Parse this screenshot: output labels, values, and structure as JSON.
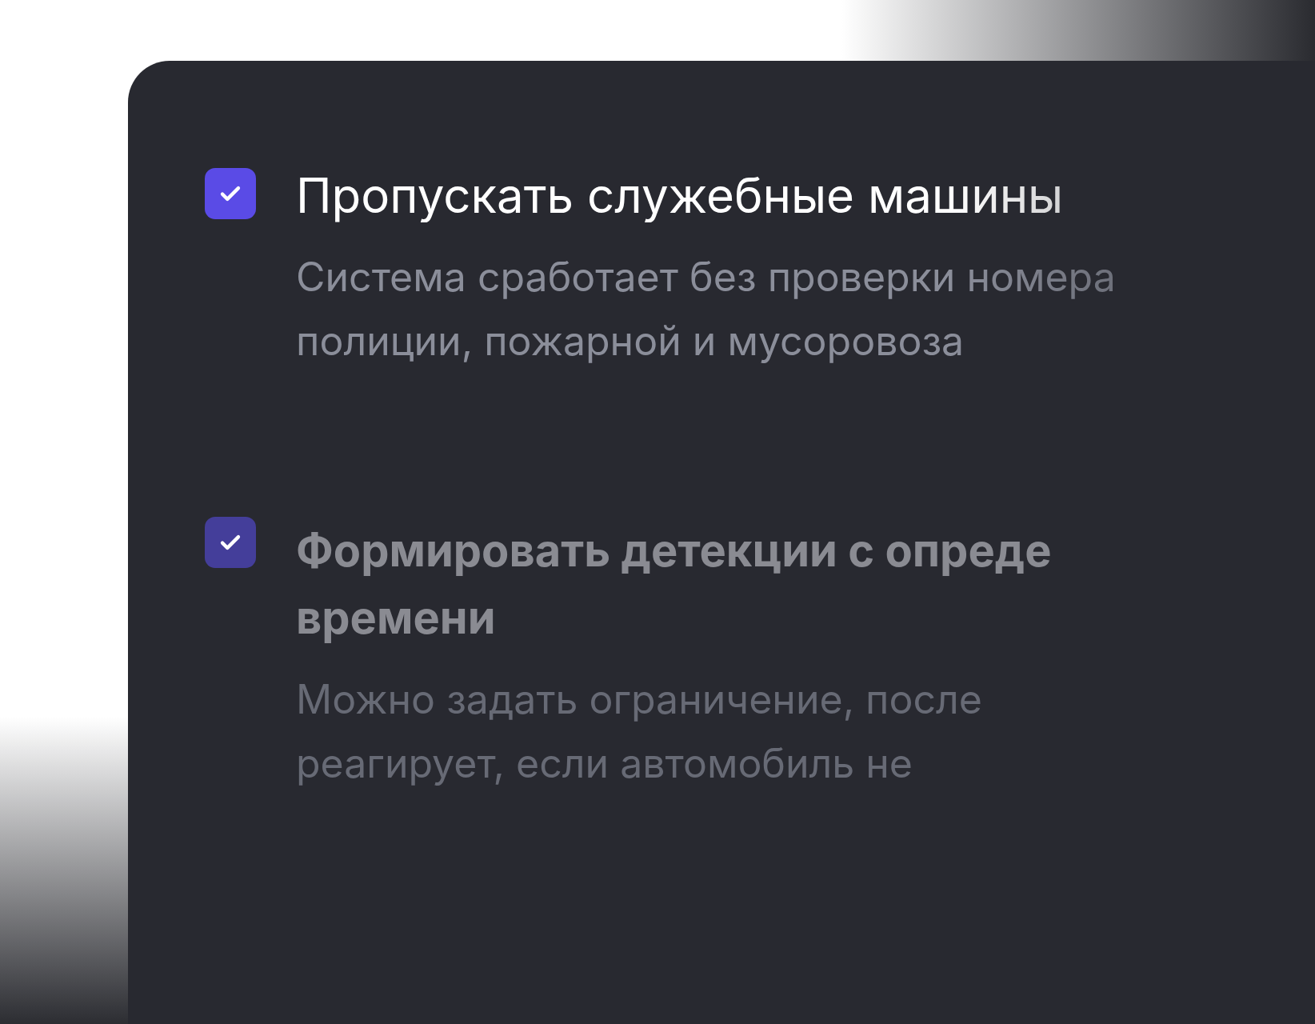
{
  "options": [
    {
      "title": "Пропускать служебные машины",
      "description": [
        "Система сработает без проверки номера",
        "полиции, пожарной и мусоровоза"
      ],
      "checked": true,
      "dimmed": false
    },
    {
      "title": "Формировать детекции с опреде",
      "title_line_2": "времени",
      "description": [
        "Можно задать ограничение, после",
        "реагирует, если автомобиль не"
      ],
      "checked": true,
      "dimmed": true
    }
  ]
}
